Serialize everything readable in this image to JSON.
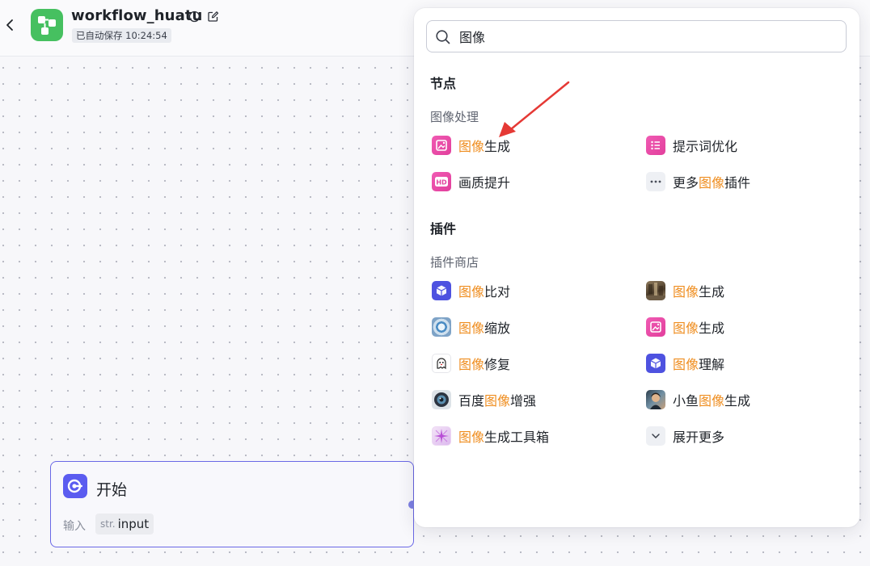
{
  "header": {
    "title": "workflow_huatu",
    "save_status": "已自动保存 10:24:54"
  },
  "search": {
    "value": "图像",
    "placeholder": ""
  },
  "popup": {
    "nodes_section": "节点",
    "nodes_group": "图像处理",
    "nodes": [
      {
        "name": "图像生成",
        "highlight": "图像",
        "rest": "生成",
        "icon": "image-generation-icon"
      },
      {
        "name": "提示词优化",
        "highlight": "",
        "rest": "提示词优化",
        "icon": "prompt-list-icon"
      },
      {
        "name": "画质提升",
        "highlight": "",
        "rest": "画质提升",
        "icon": "hd-icon"
      },
      {
        "name": "更多图像插件",
        "prefix": "更多",
        "highlight": "图像",
        "rest": "插件",
        "icon": "more-dots-icon"
      }
    ],
    "plugins_section": "插件",
    "plugins_group": "插件商店",
    "plugins": [
      {
        "prefix": "",
        "highlight": "图像",
        "rest": "比对",
        "icon": "cube-icon"
      },
      {
        "prefix": "",
        "highlight": "图像",
        "rest": "生成",
        "icon": "photo-thumbnail-icon"
      },
      {
        "prefix": "",
        "highlight": "图像",
        "rest": "缩放",
        "icon": "lens-icon"
      },
      {
        "prefix": "",
        "highlight": "图像",
        "rest": "生成",
        "icon": "image-generation-icon"
      },
      {
        "prefix": "",
        "highlight": "图像",
        "rest": "修复",
        "icon": "ghost-icon"
      },
      {
        "prefix": "",
        "highlight": "图像",
        "rest": "理解",
        "icon": "cube-icon"
      },
      {
        "prefix": "百度",
        "highlight": "图像",
        "rest": "增强",
        "icon": "camera-lens-icon"
      },
      {
        "prefix": "小鱼",
        "highlight": "图像",
        "rest": "生成",
        "icon": "photo-thumbnail-icon"
      },
      {
        "prefix": "",
        "highlight": "图像",
        "rest": "生成工具箱",
        "icon": "toolbox-icon"
      },
      {
        "prefix": "",
        "highlight": "",
        "rest": "展开更多",
        "icon": "chevron-down-icon"
      }
    ]
  },
  "start_node": {
    "title": "开始",
    "input_label": "输入",
    "param_type": "str.",
    "param_name": "input"
  },
  "colors": {
    "highlight": "#ef8d1f",
    "annotation_arrow": "#e53935",
    "start_node_border": "#6a68e6",
    "brand_green": "#46c060"
  }
}
